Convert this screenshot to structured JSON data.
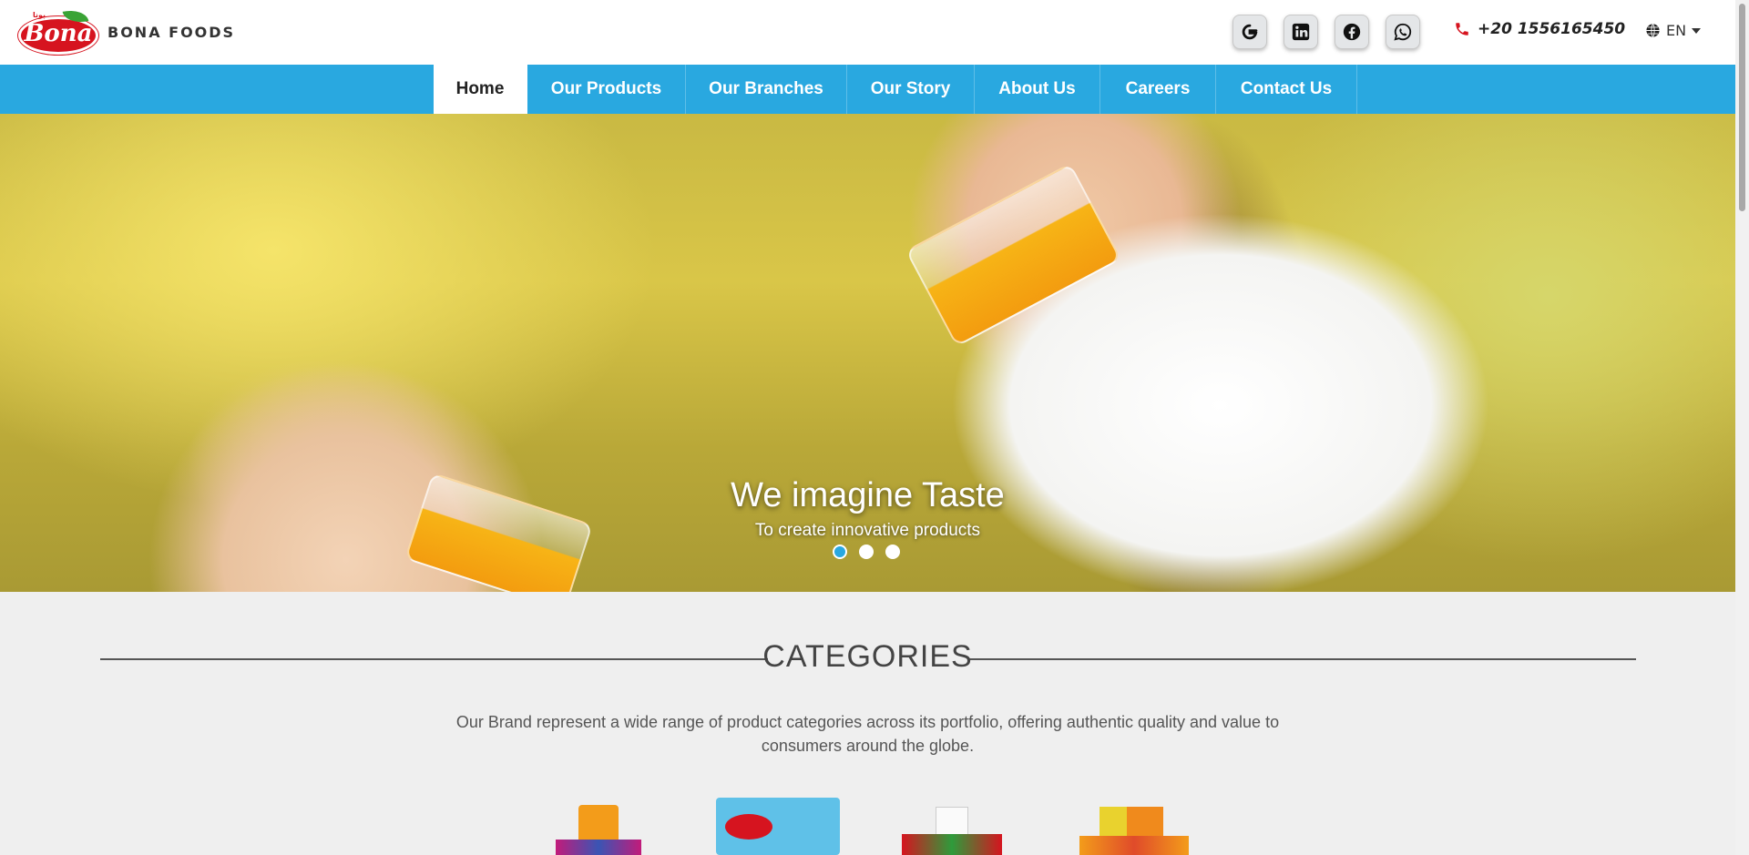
{
  "brand": {
    "logo_word": "Bona",
    "logo_small": "بونا",
    "name": "BONA FOODS",
    "primary_color": "#29a8e0",
    "logo_red": "#d6141f"
  },
  "header": {
    "social": [
      {
        "icon": "google-icon"
      },
      {
        "icon": "linkedin-icon"
      },
      {
        "icon": "facebook-icon"
      },
      {
        "icon": "whatsapp-icon"
      }
    ],
    "phone": "+20 1556165450",
    "language": "EN"
  },
  "nav": {
    "items": [
      {
        "label": "Home",
        "active": true
      },
      {
        "label": "Our Products"
      },
      {
        "label": "Our Branches"
      },
      {
        "label": "Our Story"
      },
      {
        "label": "About Us"
      },
      {
        "label": "Careers"
      },
      {
        "label": "Contact Us"
      }
    ]
  },
  "hero": {
    "title": "We imagine Taste",
    "subtitle": "To create innovative products",
    "slides": 3,
    "active_slide": 1
  },
  "categories": {
    "title": "CATEGORIES",
    "description": "Our Brand represent a wide range of product categories across its portfolio, offering authentic quality and value to consumers around the globe."
  }
}
